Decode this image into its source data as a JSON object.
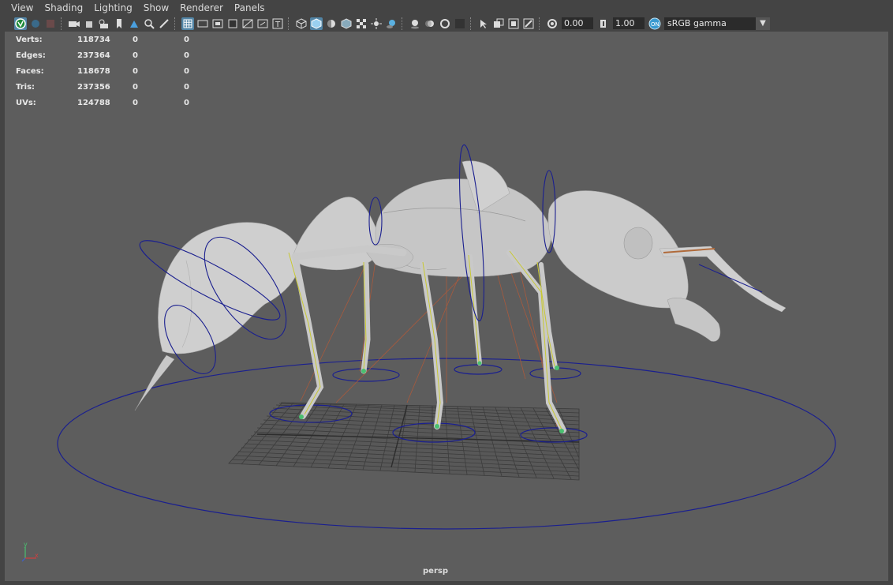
{
  "menu": [
    "View",
    "Shading",
    "Lighting",
    "Show",
    "Renderer",
    "Panels"
  ],
  "toolbar": {
    "exposure": "0.00",
    "gamma": "1.00",
    "color_space": "sRGB gamma",
    "icons": [
      "select-camera",
      "camera-attributes",
      "bookmarks",
      "image-plane",
      "2d-pan-zoom",
      "grease-pencil",
      "grid",
      "film-gate",
      "resolution-gate",
      "gate-mask",
      "field-chart",
      "safe-action",
      "safe-title",
      "wireframe",
      "smooth-shade",
      "wireframe-on-shaded",
      "textured",
      "use-all-lights",
      "shadows",
      "screen-space-ao",
      "motion-blur",
      "multisample-aa",
      "depth-of-field",
      "isolate-select",
      "xray",
      "xray-active-components",
      "xray-joints",
      "exposure",
      "gamma",
      "color-management"
    ]
  },
  "hud": [
    {
      "label": "Verts:",
      "v1": "118734",
      "v2": "0",
      "v3": "0"
    },
    {
      "label": "Edges:",
      "v1": "237364",
      "v2": "0",
      "v3": "0"
    },
    {
      "label": "Faces:",
      "v1": "118678",
      "v2": "0",
      "v3": "0"
    },
    {
      "label": "Tris:",
      "v1": "237356",
      "v2": "0",
      "v3": "0"
    },
    {
      "label": "UVs:",
      "v1": "124788",
      "v2": "0",
      "v3": "0"
    }
  ],
  "camera": "persp",
  "axis": {
    "y": "y",
    "x": "x"
  },
  "colors": {
    "viewport_bg": "#5d5d5d",
    "control_curve": "#1a1f8f",
    "mesh": "#c8c8c8",
    "ik_handle": "#c8c832",
    "pole_vector": "#b05a3a",
    "grid": "#3c3c3c"
  }
}
